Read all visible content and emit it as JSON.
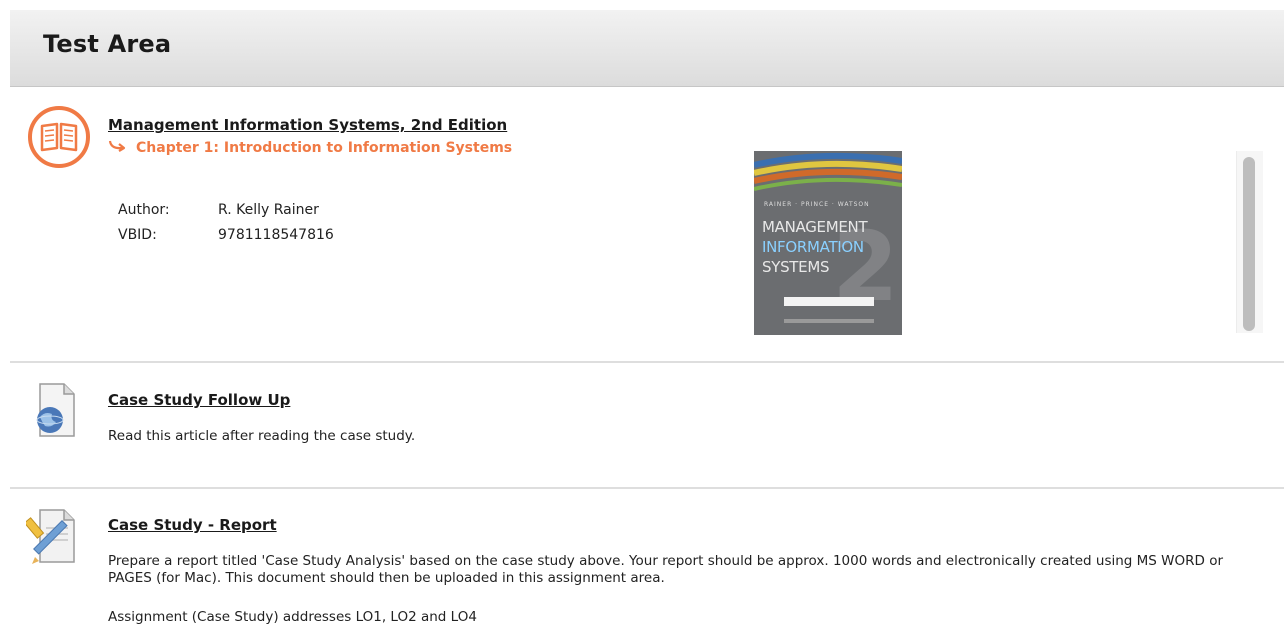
{
  "header": {
    "title": "Test Area"
  },
  "items": [
    {
      "title": "Management Information Systems, 2nd Edition",
      "chapter": "Chapter 1: Introduction to Information Systems",
      "meta": [
        {
          "label": "Author:",
          "value": "R. Kelly Rainer"
        },
        {
          "label": "VBID:",
          "value": "9781118547816"
        }
      ],
      "cover": {
        "authors": "RAINER · PRINCE · WATSON",
        "lines": [
          "MANAGEMENT",
          "INFORMATION",
          "SYSTEMS"
        ],
        "number": "2"
      }
    },
    {
      "title": "Case Study Follow Up",
      "description": "Read this article after reading the case study."
    },
    {
      "title": "Case Study - Report",
      "description": "Prepare a report titled 'Case Study Analysis'  based on the case study above.  Your report should be approx. 1000 words and electronically created using MS WORD or PAGES (for Mac).  This document should  then be uploaded in this assignment area.",
      "note": "Assignment (Case Study) addresses LO1, LO2 and LO4"
    }
  ],
  "colors": {
    "accent": "#f07a45",
    "header_bg": "#e4e4e4"
  },
  "icons": {
    "item0": "open-book-icon",
    "item1": "web-document-icon",
    "item2": "assignment-icon"
  }
}
